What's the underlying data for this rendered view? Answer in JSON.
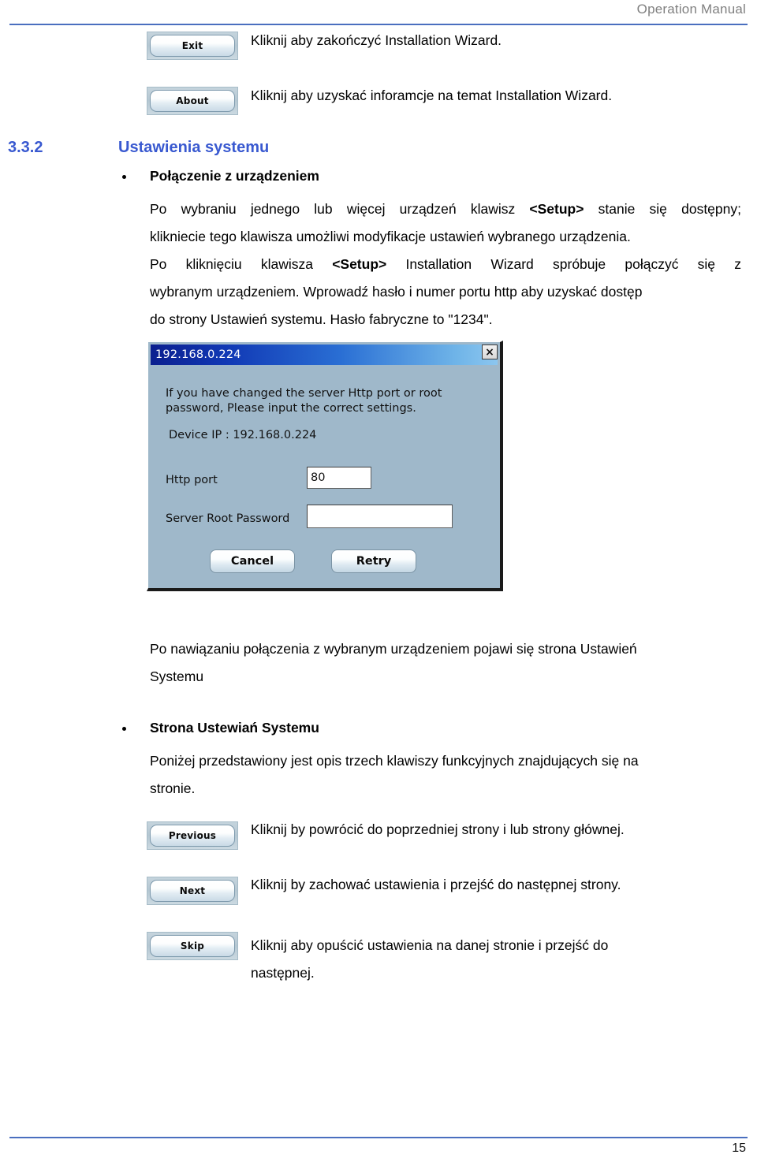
{
  "header": {
    "title": "Operation Manual"
  },
  "footer": {
    "page_number": "15"
  },
  "top_buttons": [
    {
      "label": "Exit",
      "description": "Kliknij aby zakończyć Installation Wizard."
    },
    {
      "label": "About",
      "description": "Kliknij aby uzyskać inforamcje na temat Installation Wizard."
    }
  ],
  "section": {
    "number": "3.3.2",
    "title": "Ustawienia systemu",
    "heading_color": "#3959d0"
  },
  "bullets": {
    "connection": {
      "heading": "Połączenie z urządzeniem",
      "lines": [
        "Po wybraniu jednego lub więcej urządzeń klawisz <Setup> stanie się dostępny;",
        "klikniecie tego klawisza umożliwi modyfikacje ustawień wybranego urządzenia.",
        "Po kliknięciu klawisza <Setup> Installation Wizard spróbuje połączyć się z",
        "wybranym urządzeniem. Wprowadź hasło i numer portu http aby uzyskać dostęp",
        "do strony Ustawień systemu. Hasło fabryczne to \"1234\"."
      ],
      "line1_a": "Po wybraniu jednego lub więcej urządzeń klawisz ",
      "line1_b": "<Setup>",
      "line1_c": " stanie się dostępny;",
      "line2": "klikniecie tego klawisza umożliwi modyfikacje ustawień wybranego urządzenia.",
      "line3_a": "Po kliknięciu klawisza ",
      "line3_b": "<Setup>",
      "line3_c": " Installation Wizard spróbuje połączyć się z",
      "line4": "wybranym urządzeniem. Wprowadź hasło i numer portu http aby uzyskać dostęp",
      "line5": "do strony Ustawień systemu. Hasło fabryczne to \"1234\"."
    },
    "after_dialog": {
      "line1": "Po nawiązaniu połączenia z wybranym urządzeniem pojawi się strona Ustawień",
      "line2": "Systemu"
    },
    "settings_page": {
      "heading": "Strona Ustewiań Systemu",
      "line1": "Poniżej przedstawiony jest opis trzech klawiszy funkcyjnych znajdujących się na",
      "line2": "stronie."
    }
  },
  "dialog": {
    "title": "192.168.0.224",
    "close_icon": "×",
    "message_line1": "If you have changed the server Http port or root",
    "message_line2": "password, Please input the correct settings.",
    "device_ip_label": "Device IP : 192.168.0.224",
    "http_port_label": "Http port",
    "http_port_value": "80",
    "password_label": "Server Root Password",
    "password_value": "",
    "cancel_label": "Cancel",
    "retry_label": "Retry",
    "body_color": "#9fb8ca"
  },
  "bottom_buttons": [
    {
      "label": "Previous",
      "description_line1": "Kliknij by powrócić do poprzedniej strony i lub strony głównej.",
      "description_line2": ""
    },
    {
      "label": "Next",
      "description_line1": "Kliknij by zachować ustawienia i przejść do następnej strony.",
      "description_line2": ""
    },
    {
      "label": "Skip",
      "description_line1": "Kliknij aby opuścić ustawienia na danej stronie i przejść do",
      "description_line2": "następnej."
    }
  ]
}
